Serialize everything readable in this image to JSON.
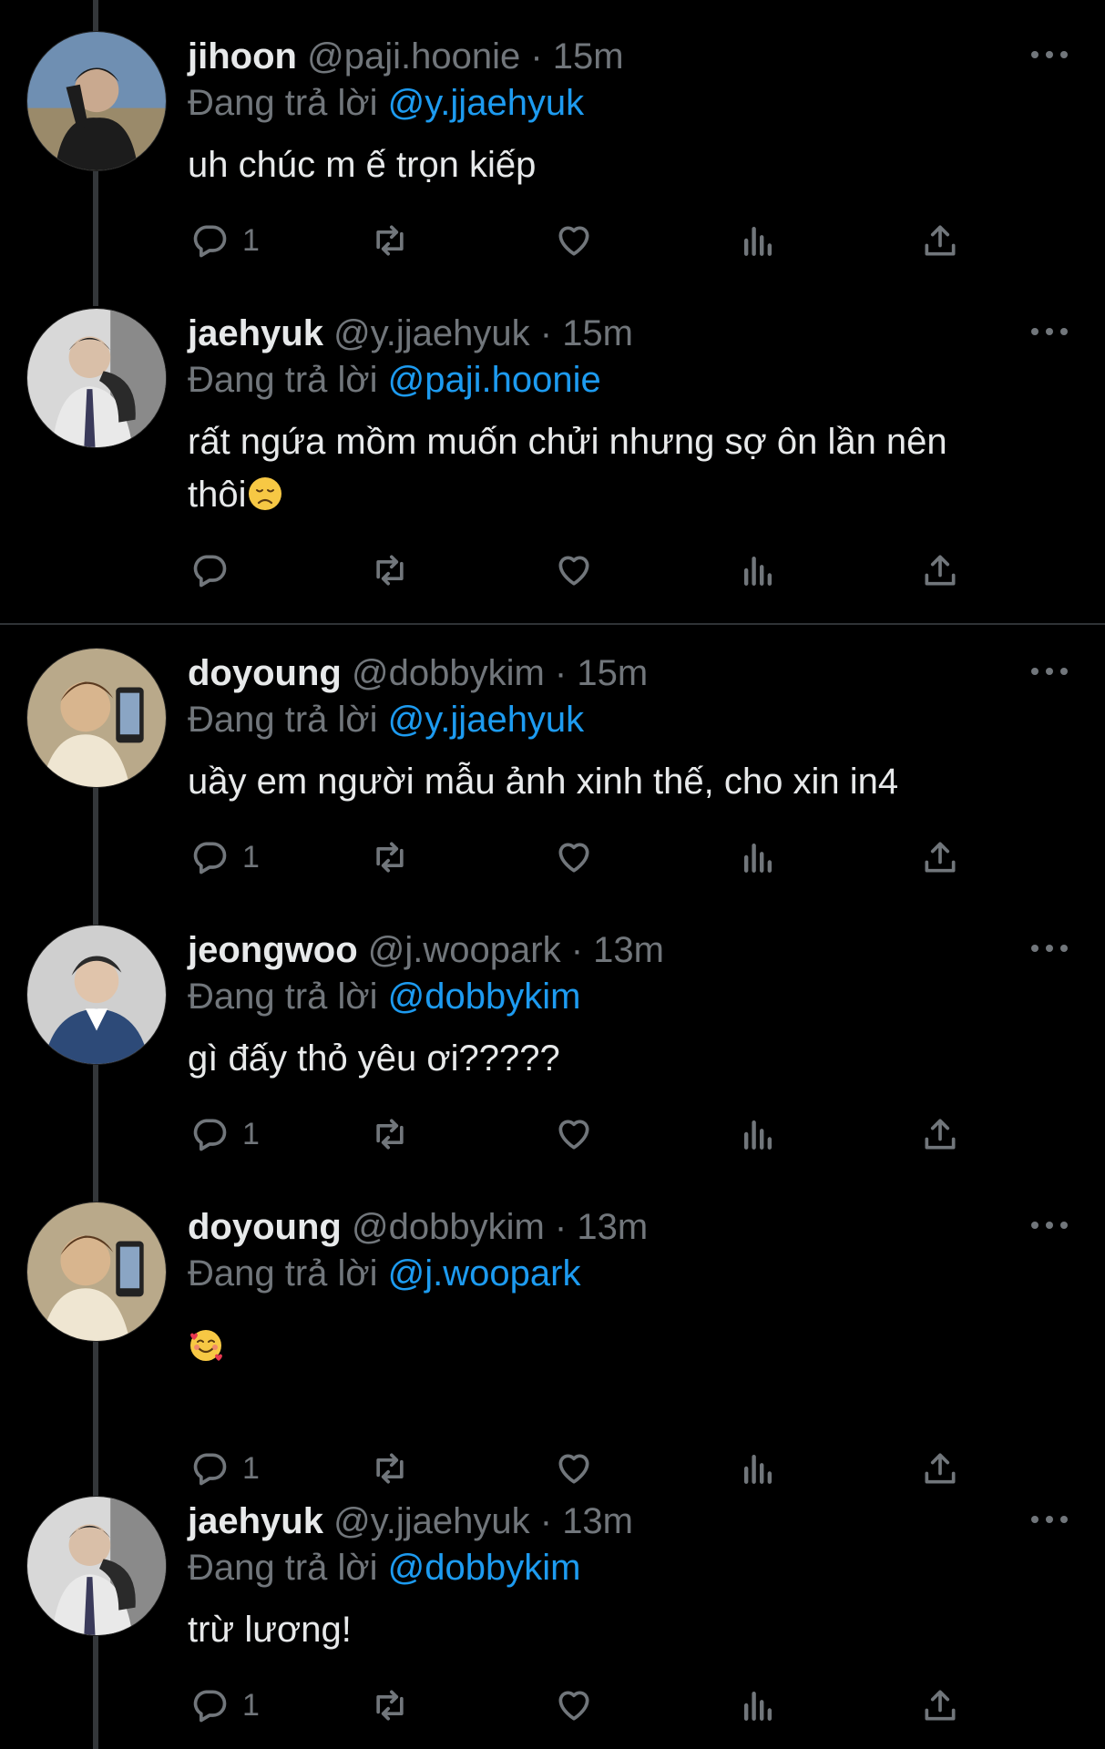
{
  "tweets": [
    {
      "name": "jihoon",
      "handle": "@paji.hoonie",
      "time": "15m",
      "reply_prefix": "Đang trả lời",
      "reply_to": "@y.jjaehyuk",
      "text": "uh chúc m ế trọn kiếp",
      "reply_count": "1",
      "avatar": "jihoon"
    },
    {
      "name": "jaehyuk",
      "handle": "@y.jjaehyuk",
      "time": "15m",
      "reply_prefix": "Đang trả lời",
      "reply_to": "@paji.hoonie",
      "text": "rất ngứa mồm muốn chửi nhưng sợ ôn lần nên thôi",
      "reply_count": "",
      "emoji": "disappointed-face",
      "avatar": "jaehyuk"
    },
    {
      "name": "doyoung",
      "handle": "@dobbykim",
      "time": "15m",
      "reply_prefix": "Đang trả lời",
      "reply_to": "@y.jjaehyuk",
      "text": "uầy em người mẫu ảnh xinh thế, cho xin in4",
      "reply_count": "1",
      "avatar": "doyoung"
    },
    {
      "name": "jeongwoo",
      "handle": "@j.woopark",
      "time": "13m",
      "reply_prefix": "Đang trả lời",
      "reply_to": "@dobbykim",
      "text": "gì đấy thỏ yêu ơi?????",
      "reply_count": "1",
      "avatar": "jeongwoo"
    },
    {
      "name": "doyoung",
      "handle": "@dobbykim",
      "time": "13m",
      "reply_prefix": "Đang trả lời",
      "reply_to": "@j.woopark",
      "text": "",
      "emoji": "smiling-face-with-hearts",
      "reply_count": "1",
      "avatar": "doyoung"
    },
    {
      "name": "jaehyuk",
      "handle": "@y.jjaehyuk",
      "time": "13m",
      "reply_prefix": "Đang trả lời",
      "reply_to": "@dobbykim",
      "text": "trừ lương!",
      "reply_count": "1",
      "avatar": "jaehyuk"
    }
  ],
  "icons": {
    "more": "more-icon",
    "reply": "reply-icon",
    "retweet": "retweet-icon",
    "like": "like-icon",
    "views": "views-icon",
    "share": "share-icon"
  },
  "colors": {
    "background": "#000000",
    "text": "#e7e9ea",
    "secondary": "#71767b",
    "accent": "#1d9bf0"
  }
}
